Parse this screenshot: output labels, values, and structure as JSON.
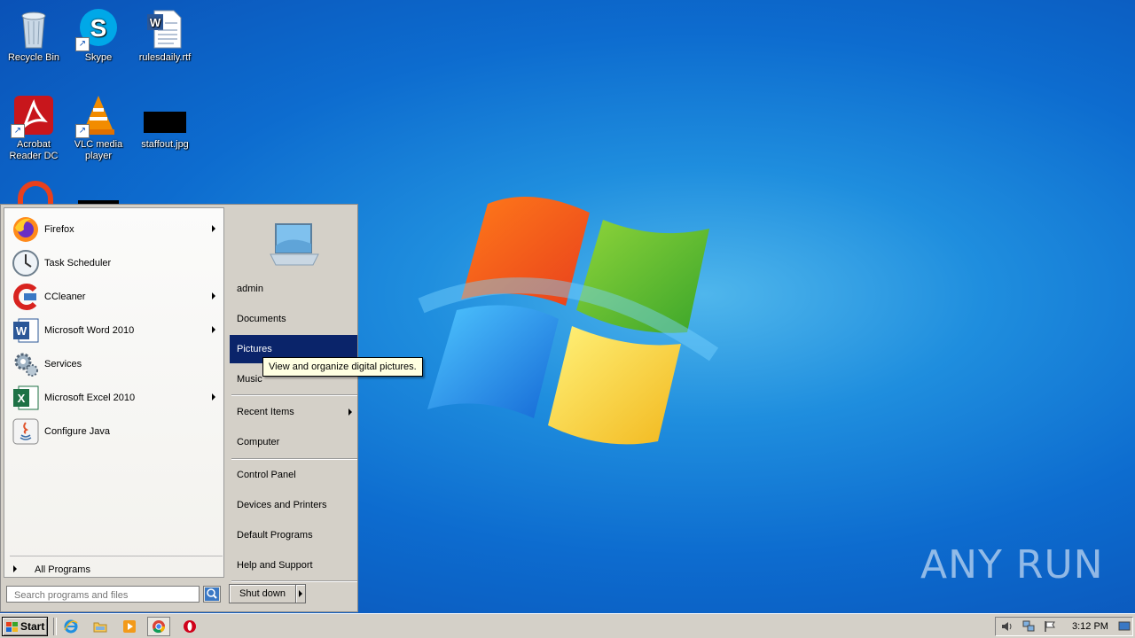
{
  "desktop": {
    "icons": [
      {
        "label": "Recycle Bin",
        "icon": "recycle-bin-icon"
      },
      {
        "label": "Skype",
        "icon": "skype-icon"
      },
      {
        "label": "rulesdaily.rtf",
        "icon": "word-document-icon"
      },
      {
        "label": "Acrobat Reader DC",
        "icon": "acrobat-reader-icon"
      },
      {
        "label": "VLC media player",
        "icon": "vlc-icon"
      },
      {
        "label": "staffout.jpg",
        "icon": "image-file-icon"
      }
    ],
    "watermark": "ANY RUN"
  },
  "start_menu": {
    "programs": [
      {
        "label": "Firefox",
        "icon": "firefox-icon",
        "has_submenu": true
      },
      {
        "label": "Task Scheduler",
        "icon": "clock-icon",
        "has_submenu": false
      },
      {
        "label": "CCleaner",
        "icon": "ccleaner-icon",
        "has_submenu": true
      },
      {
        "label": "Microsoft Word 2010",
        "icon": "word-icon",
        "has_submenu": true
      },
      {
        "label": "Services",
        "icon": "gears-icon",
        "has_submenu": false
      },
      {
        "label": "Microsoft Excel 2010",
        "icon": "excel-icon",
        "has_submenu": true
      },
      {
        "label": "Configure Java",
        "icon": "java-icon",
        "has_submenu": false
      }
    ],
    "all_programs": "All Programs",
    "search_placeholder": "Search programs and files",
    "places": [
      {
        "label": "admin"
      },
      {
        "label": "Documents"
      },
      {
        "label": "Pictures",
        "selected": true
      },
      {
        "label": "Music"
      },
      {
        "label": "Recent Items",
        "has_submenu": true
      },
      {
        "label": "Computer"
      },
      {
        "label": "Control Panel"
      },
      {
        "label": "Devices and Printers"
      },
      {
        "label": "Default Programs"
      },
      {
        "label": "Help and Support"
      }
    ],
    "shutdown_label": "Shut down",
    "tooltip": "View and organize digital pictures."
  },
  "taskbar": {
    "start_label": "Start",
    "quick_launch": [
      "internet-explorer-icon",
      "explorer-folder-icon",
      "media-player-icon",
      "chrome-icon",
      "opera-icon"
    ],
    "clock": "3:12 PM"
  },
  "colors": {
    "selection": "#0a246a",
    "menu_bg": "#d4d0c8",
    "desktop_blue": "#0d6ccf",
    "tooltip_bg": "#ffffe1"
  }
}
